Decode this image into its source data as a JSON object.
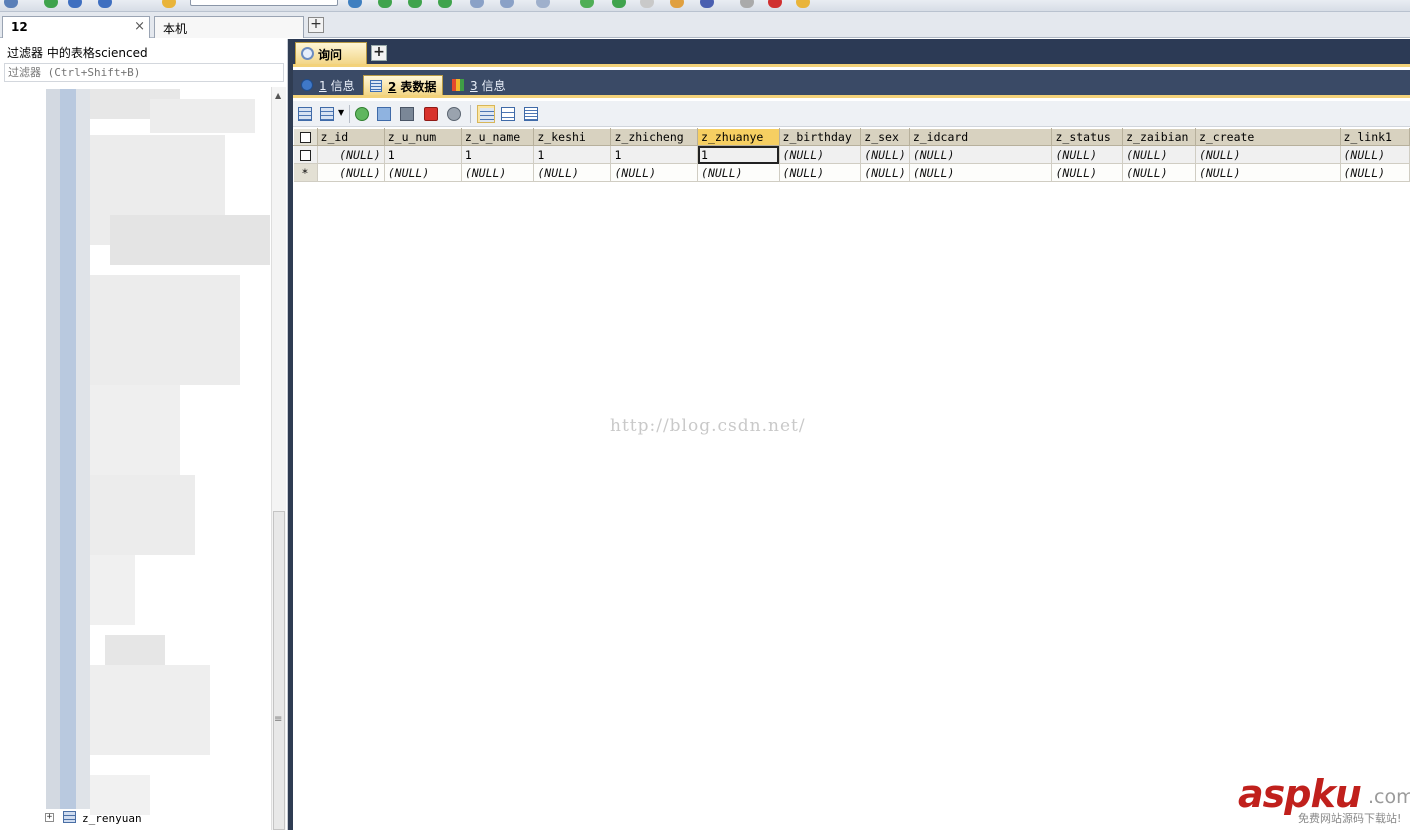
{
  "connection_tabs": {
    "active": "12",
    "close": "×",
    "other": "本机",
    "add": "+"
  },
  "object_browser": {
    "filter_title": "过滤器 中的表格scienced",
    "filter_placeholder": "过滤器 (Ctrl+Shift+B)",
    "last_visible_table": "z_renyuan",
    "expander": "+"
  },
  "query_tabs": {
    "active": "询问",
    "add": "+"
  },
  "result_tabs": [
    {
      "num": "1",
      "label": "信息"
    },
    {
      "num": "2",
      "label": "表数据"
    },
    {
      "num": "3",
      "label": "信息"
    }
  ],
  "result_toolbar": {
    "icons": [
      "insert-row-icon",
      "export-icon",
      "add-row-icon",
      "duplicate-icon",
      "save-icon",
      "delete-icon",
      "cancel-icon",
      "grid-view-icon",
      "form-view-icon",
      "text-view-icon"
    ]
  },
  "grid": {
    "columns": [
      "z_id",
      "z_u_num",
      "z_u_name",
      "z_keshi",
      "z_zhicheng",
      "z_zhuanye",
      "z_birthday",
      "z_sex",
      "z_idcard",
      "z_status",
      "z_zaibian",
      "z_create",
      "z_link1"
    ],
    "selected_column": "z_zhuanye",
    "rows": [
      {
        "marker": "",
        "cells": [
          "(NULL)",
          "1",
          "1",
          "1",
          "1",
          "1",
          "(NULL)",
          "(NULL)",
          "(NULL)",
          "(NULL)",
          "(NULL)",
          "(NULL)",
          "(NULL)"
        ]
      },
      {
        "marker": "*",
        "cells": [
          "(NULL)",
          "(NULL)",
          "(NULL)",
          "(NULL)",
          "(NULL)",
          "(NULL)",
          "(NULL)",
          "(NULL)",
          "(NULL)",
          "(NULL)",
          "(NULL)",
          "(NULL)",
          "(NULL)"
        ]
      }
    ]
  },
  "watermarks": {
    "url": "http://blog.csdn.net/",
    "logo": "aspku",
    "logo_suffix": ".com",
    "logo_sub": "免费网站源码下载站!"
  },
  "colors": {
    "accent_tab": "#f2d688",
    "header_bar": "#2c3a55",
    "grid_header": "#d8d2c0",
    "selected_header": "#f6cf62"
  }
}
